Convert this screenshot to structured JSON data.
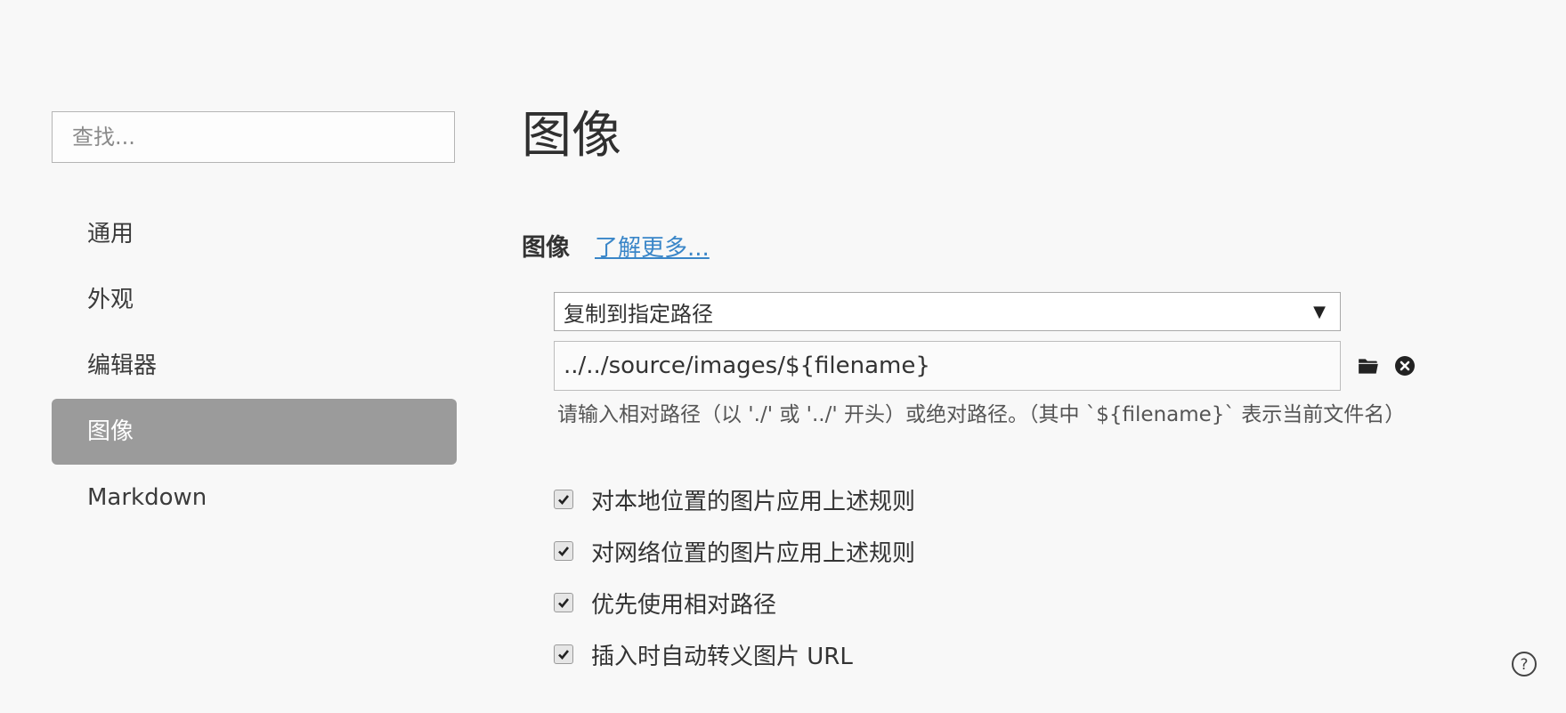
{
  "sidebar": {
    "search_placeholder": "查找...",
    "items": [
      {
        "label": "通用"
      },
      {
        "label": "外观"
      },
      {
        "label": "编辑器"
      },
      {
        "label": "图像",
        "active": true
      },
      {
        "label": "Markdown"
      }
    ]
  },
  "main": {
    "page_title": "图像",
    "section_title": "图像",
    "learn_more": "了解更多...",
    "image_action": {
      "selected": "复制到指定路径"
    },
    "path": {
      "value": "../../source/images/${filename}"
    },
    "hint": "请输入相对路径（以 './' 或 '../' 开头）或绝对路径。（其中 `${filename}` 表示当前文件名）",
    "options": [
      {
        "label": "对本地位置的图片应用上述规则",
        "checked": true
      },
      {
        "label": "对网络位置的图片应用上述规则",
        "checked": true
      },
      {
        "label": "优先使用相对路径",
        "checked": true
      },
      {
        "label": "插入时自动转义图片 URL",
        "checked": true
      }
    ]
  },
  "icons": {
    "folder": "folder-icon",
    "clear": "close-circle-icon",
    "help": "help-icon",
    "dropdown": "triangle-down-icon",
    "check": "check-icon"
  },
  "colors": {
    "background": "#f8f8f8",
    "active_nav": "#9b9b9b",
    "link": "#3a86c8"
  }
}
